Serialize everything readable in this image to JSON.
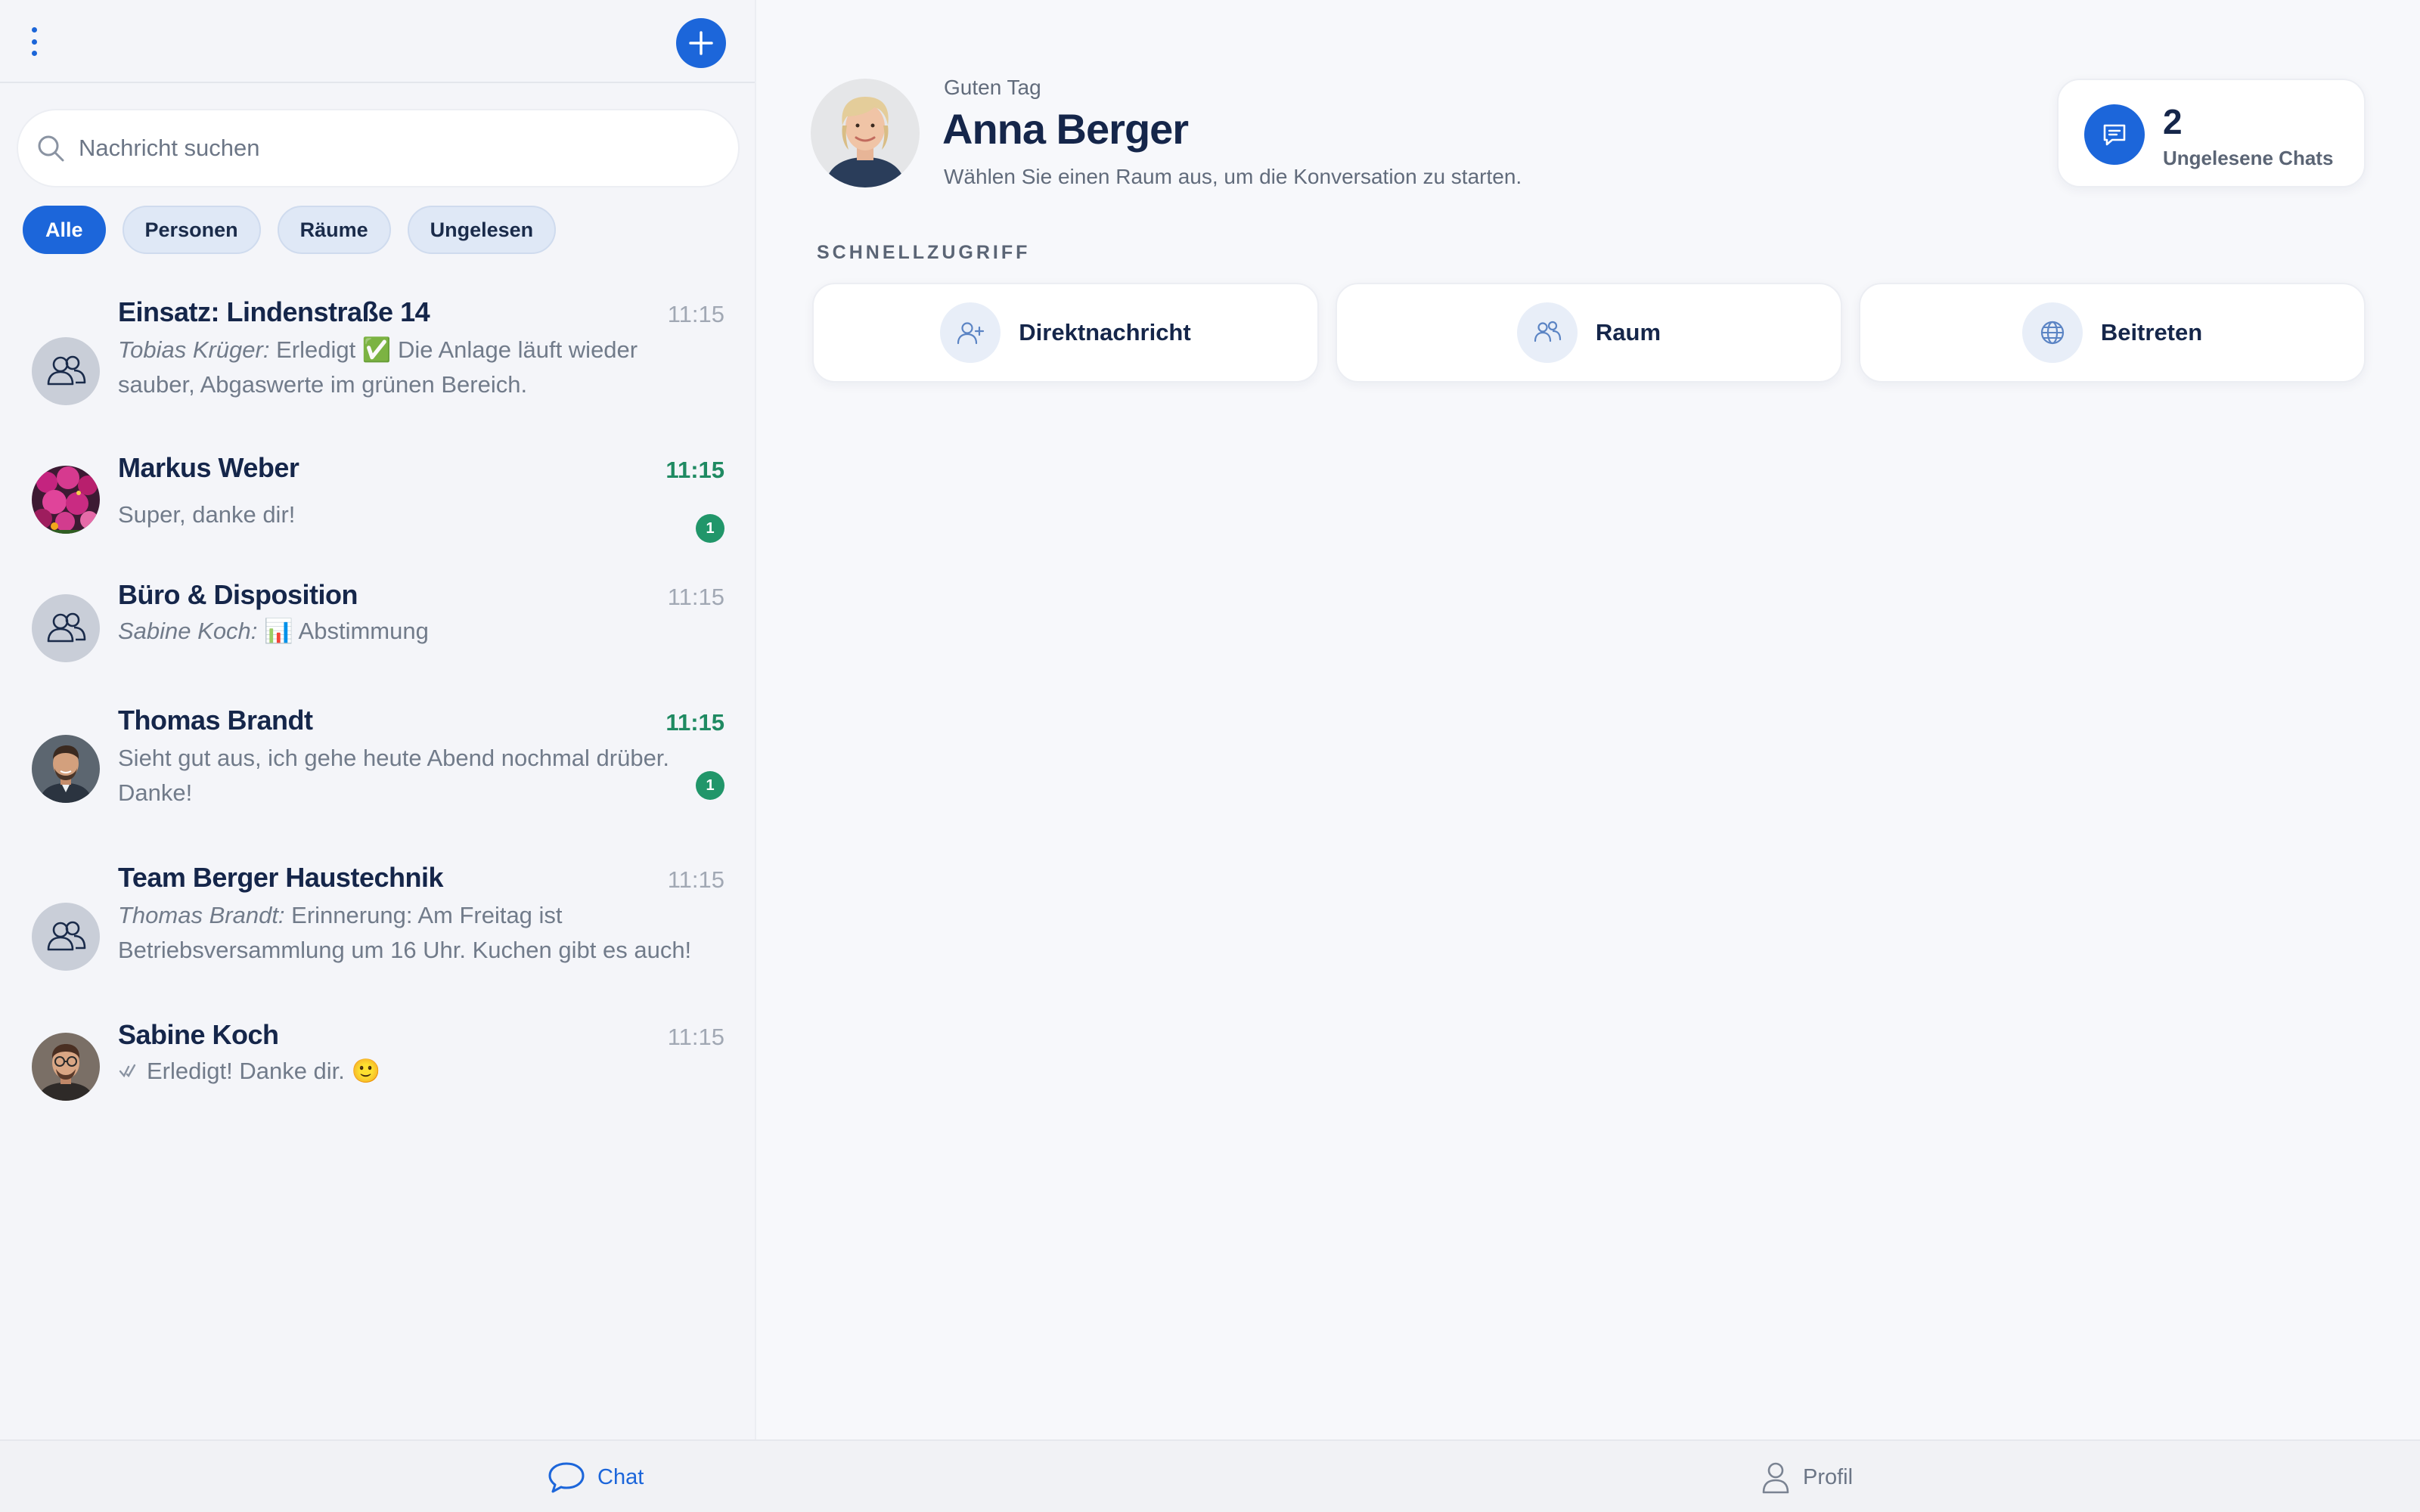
{
  "search": {
    "placeholder": "Nachricht suchen"
  },
  "filters": [
    {
      "label": "Alle",
      "active": true
    },
    {
      "label": "Personen",
      "active": false
    },
    {
      "label": "Räume",
      "active": false
    },
    {
      "label": "Ungelesen",
      "active": false
    }
  ],
  "chats": [
    {
      "name": "Einsatz: Lindenstraße 14",
      "time": "11:15",
      "sender": "Tobias Krüger:",
      "preview": " Erledigt ✅ Die Anlage läuft wieder sauber, Abgaswerte im grünen Bereich.",
      "unread": false,
      "avatar": "group-icon"
    },
    {
      "name": "Markus Weber",
      "time": "11:15",
      "sender": "",
      "preview": "Super, danke dir!",
      "unread": true,
      "badge": "1",
      "avatar": "flowers-photo"
    },
    {
      "name": "Büro & Disposition",
      "time": "11:15",
      "sender": "Sabine Koch:",
      "preview": " 📊 Abstimmung",
      "unread": false,
      "avatar": "group-icon"
    },
    {
      "name": "Thomas Brandt",
      "time": "11:15",
      "sender": "",
      "preview": "Sieht gut aus, ich gehe heute Abend nochmal drüber. Danke!",
      "unread": true,
      "badge": "1",
      "avatar": "man-photo"
    },
    {
      "name": "Team Berger Haustechnik",
      "time": "11:15",
      "sender": "Thomas Brandt:",
      "preview": " Erinnerung: Am Freitag ist Betriebsversammlung um 16 Uhr. Kuchen gibt es auch!",
      "unread": false,
      "avatar": "group-icon"
    },
    {
      "name": "Sabine Koch",
      "time": "11:15",
      "sender": "",
      "preview": "Erledigt! Danke dir. 🙂",
      "unread": false,
      "read_receipt": true,
      "avatar": "man-glasses-photo"
    }
  ],
  "main": {
    "greeting": "Guten Tag",
    "user_name": "Anna Berger",
    "subtitle": "Wählen Sie einen Raum aus, um die Konversation zu starten.",
    "unread_count": "2",
    "unread_label": "Ungelesene Chats",
    "section_title": "SCHNELLZUGRIFF",
    "quick_actions": [
      {
        "label": "Direktnachricht",
        "icon": "person-add-icon"
      },
      {
        "label": "Raum",
        "icon": "people-icon"
      },
      {
        "label": "Beitreten",
        "icon": "globe-icon"
      }
    ]
  },
  "nav": {
    "chat_label": "Chat",
    "profile_label": "Profil"
  },
  "colors": {
    "accent": "#1c66da",
    "unread_green": "#21966a",
    "text_dark": "#15264a"
  }
}
